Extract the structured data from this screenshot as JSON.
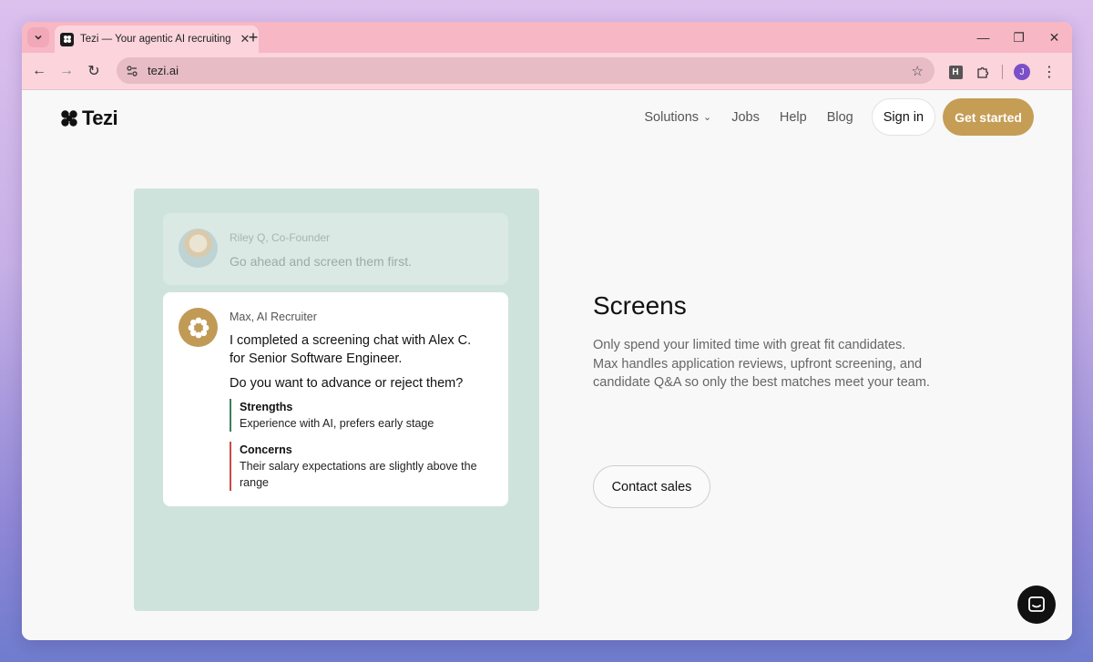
{
  "browser": {
    "tab_title": "Tezi — Your agentic AI recruiting",
    "url": "tezi.ai",
    "profile_initial": "J",
    "extension_badge": "H"
  },
  "header": {
    "logo_text": "Tezi",
    "nav": [
      "Solutions",
      "Jobs",
      "Help",
      "Blog"
    ],
    "sign_in": "Sign in",
    "get_started": "Get started"
  },
  "demo": {
    "faded_card": {
      "name": "Riley Q, Co-Founder",
      "message": "Go ahead and screen them first."
    },
    "main_card": {
      "name": "Max, AI Recruiter",
      "message": "I completed a screening chat with Alex C. for Senior Software Engineer.",
      "question": "Do you want to advance or reject them?",
      "strengths_title": "Strengths",
      "strengths_body": "Experience with AI, prefers early stage",
      "concerns_title": "Concerns",
      "concerns_body": "Their salary expectations are slightly above the range"
    }
  },
  "feature": {
    "title": "Screens",
    "description": "Only spend your limited time with great fit candidates. Max handles application reviews, upfront screening, and candidate Q&A so only the best matches meet your team.",
    "cta": "Contact sales"
  },
  "colors": {
    "accent": "#c59d55",
    "panel": "#cfe3dd",
    "strength": "#3f7d5b",
    "concern": "#c84b44"
  }
}
